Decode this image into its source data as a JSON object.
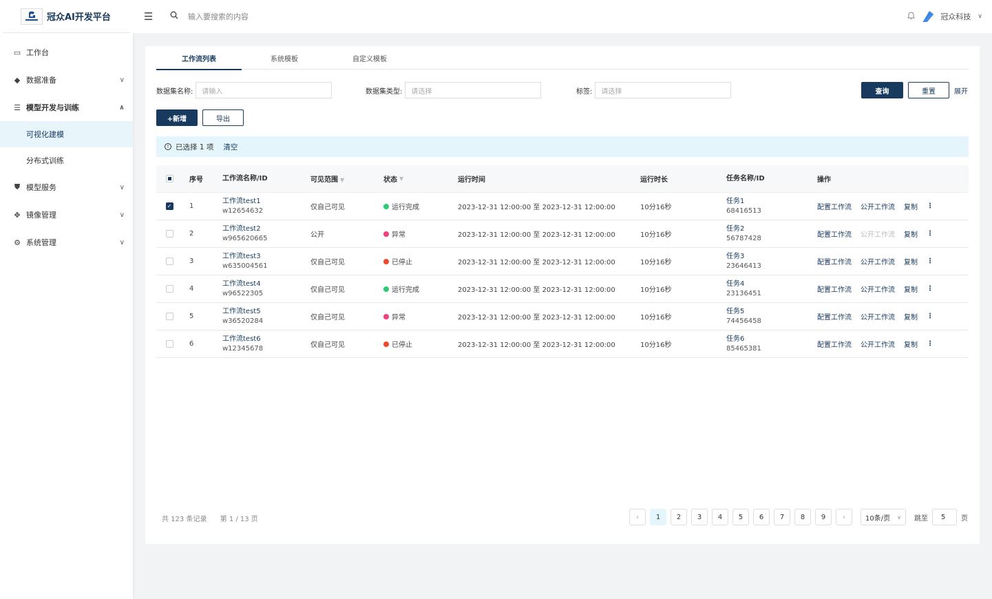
{
  "app": {
    "title": "冠众AI开发平台",
    "logo_text": "冠众科技"
  },
  "sidebar": {
    "items": [
      {
        "label": "工作台",
        "icon": "laptop-icon",
        "glyph": "▭",
        "chevron": ""
      },
      {
        "label": "数据准备",
        "icon": "cube-icon",
        "glyph": "◆",
        "chevron": "∨"
      },
      {
        "label": "模型开发与训练",
        "icon": "database-icon",
        "glyph": "☰",
        "chevron": "∧"
      },
      {
        "label": "模型服务",
        "icon": "shield-icon",
        "glyph": "⛊",
        "chevron": "∨"
      },
      {
        "label": "镜像管理",
        "icon": "move-icon",
        "glyph": "✥",
        "chevron": "∨"
      },
      {
        "label": "系统管理",
        "icon": "gear-icon",
        "glyph": "⚙",
        "chevron": "∨"
      }
    ],
    "sub_items": [
      {
        "label": "可视化建模"
      },
      {
        "label": "分布式训练"
      }
    ]
  },
  "header": {
    "search_placeholder": "输入要搜索的内容",
    "user_name": "冠众科技"
  },
  "tabs": [
    {
      "label": "工作流列表"
    },
    {
      "label": "系统模板"
    },
    {
      "label": "自定义模板"
    }
  ],
  "filters": {
    "dataset_name_label": "数据集名称:",
    "dataset_name_placeholder": "请输入",
    "dataset_type_label": "数据集类型:",
    "dataset_type_placeholder": "请选择",
    "tag_label": "标签:",
    "tag_placeholder": "请选择",
    "query_label": "查询",
    "reset_label": "重置",
    "expand_label": "展开"
  },
  "actions": {
    "add_label": "+新增",
    "export_label": "导出"
  },
  "notice": {
    "text": "已选择 1 项",
    "clear_label": "清空"
  },
  "table": {
    "columns": [
      "序号",
      "工作流名称/ID",
      "可见范围",
      "状态",
      "运行时间",
      "运行时长",
      "任务名称/ID",
      "操作"
    ],
    "ops": {
      "config": "配置工作流",
      "publish": "公开工作流",
      "copy": "复制"
    },
    "rows": [
      {
        "idx": "1",
        "name": "工作流test1",
        "id": "w12654632",
        "visibility": "仅自己可见",
        "status": "运行完成",
        "status_color": "#2ecc71",
        "time": "2023-12-31 12:00:00 至 2023-12-31 12:00:00",
        "duration": "10分16秒",
        "task": "任务1",
        "task_id": "68416513",
        "checked": true,
        "publish_disabled": false
      },
      {
        "idx": "2",
        "name": "工作流test2",
        "id": "w965620665",
        "visibility": "公开",
        "status": "异常",
        "status_color": "#f0427a",
        "time": "2023-12-31 12:00:00 至 2023-12-31 12:00:00",
        "duration": "10分16秒",
        "task": "任务2",
        "task_id": "56787428",
        "checked": false,
        "publish_disabled": true
      },
      {
        "idx": "3",
        "name": "工作流test3",
        "id": "w635004561",
        "visibility": "仅自己可见",
        "status": "已停止",
        "status_color": "#f04a2e",
        "time": "2023-12-31 12:00:00 至 2023-12-31 12:00:00",
        "duration": "10分16秒",
        "task": "任务3",
        "task_id": "23646413",
        "checked": false,
        "publish_disabled": false
      },
      {
        "idx": "4",
        "name": "工作流test4",
        "id": "w96522305",
        "visibility": "仅自己可见",
        "status": "运行完成",
        "status_color": "#2ecc71",
        "time": "2023-12-31 12:00:00 至 2023-12-31 12:00:00",
        "duration": "10分16秒",
        "task": "任务4",
        "task_id": "23136451",
        "checked": false,
        "publish_disabled": false
      },
      {
        "idx": "5",
        "name": "工作流test5",
        "id": "w36520284",
        "visibility": "仅自己可见",
        "status": "异常",
        "status_color": "#f0427a",
        "time": "2023-12-31 12:00:00 至 2023-12-31 12:00:00",
        "duration": "10分16秒",
        "task": "任务5",
        "task_id": "74456458",
        "checked": false,
        "publish_disabled": false
      },
      {
        "idx": "6",
        "name": "工作流test6",
        "id": "w12345678",
        "visibility": "仅自己可见",
        "status": "已停止",
        "status_color": "#f04a2e",
        "time": "2023-12-31 12:00:00 至 2023-12-31 12:00:00",
        "duration": "10分16秒",
        "task": "任务6",
        "task_id": "85465381",
        "checked": false,
        "publish_disabled": false
      }
    ]
  },
  "pagination": {
    "total_text": "共 123 条记录",
    "page_text": "第 1 / 13 页",
    "pages": [
      "1",
      "2",
      "3",
      "4",
      "5",
      "6",
      "7",
      "8",
      "9"
    ],
    "current": "1",
    "page_size": "10条/页",
    "jump_label": "跳至",
    "jump_value": "5",
    "page_unit": "页"
  },
  "colors": {
    "primary": "#173a5e",
    "highlight_bg": "#e4f6fb"
  }
}
